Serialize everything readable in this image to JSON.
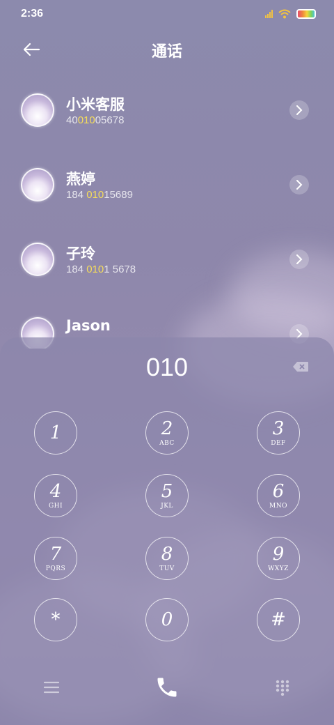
{
  "status": {
    "time": "2:36"
  },
  "header": {
    "title": "通话"
  },
  "contacts": [
    {
      "name": "小米客服",
      "number_pre": "40",
      "number_hl": "010",
      "number_post": "05678"
    },
    {
      "name": "燕婷",
      "number_pre": "184 ",
      "number_hl": "010",
      "number_post": "15689"
    },
    {
      "name": "子玲",
      "number_pre": "184 ",
      "number_hl": "010",
      "number_post": "1 5678"
    },
    {
      "name": "Jason",
      "number_pre": "",
      "number_hl": "",
      "number_post": ""
    }
  ],
  "dialer": {
    "input": "010",
    "keys": [
      {
        "digit": "1",
        "letters": ""
      },
      {
        "digit": "2",
        "letters": "ABC"
      },
      {
        "digit": "3",
        "letters": "DEF"
      },
      {
        "digit": "4",
        "letters": "GHI"
      },
      {
        "digit": "5",
        "letters": "JKL"
      },
      {
        "digit": "6",
        "letters": "MNO"
      },
      {
        "digit": "7",
        "letters": "PQRS"
      },
      {
        "digit": "8",
        "letters": "TUV"
      },
      {
        "digit": "9",
        "letters": "WXYZ"
      },
      {
        "digit": "*",
        "letters": ""
      },
      {
        "digit": "0",
        "letters": ""
      },
      {
        "digit": "#",
        "letters": ""
      }
    ]
  },
  "colors": {
    "highlight": "#f5dc5a",
    "background": "#8e87ab"
  },
  "icons": {
    "back": "arrow-left-icon",
    "detail": "chevron-right-icon",
    "backspace": "backspace-icon",
    "menu": "menu-icon",
    "call": "phone-icon",
    "keypad": "keypad-icon"
  }
}
